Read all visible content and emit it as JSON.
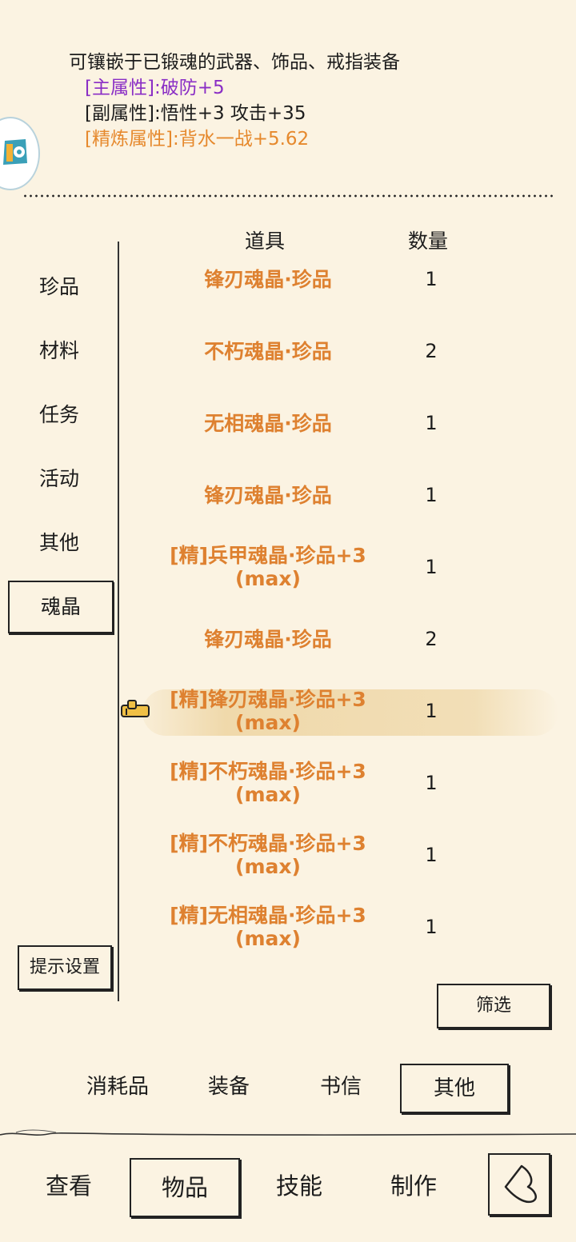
{
  "description": {
    "line1": "可镶嵌于已锻魂的武器、饰品、戒指装备",
    "main_attr": "[主属性]:破防+5",
    "sub_attr": "[副属性]:悟性+3 攻击+35",
    "refine_attr": "[精炼属性]:背水一战+5.62"
  },
  "table_header": {
    "item": "道具",
    "count": "数量"
  },
  "categories": [
    {
      "label": "珍品"
    },
    {
      "label": "材料"
    },
    {
      "label": "任务"
    },
    {
      "label": "活动"
    },
    {
      "label": "其他"
    },
    {
      "label": "魂晶"
    }
  ],
  "active_category": "魂晶",
  "items": [
    {
      "name": "锋刃魂晶·珍品",
      "qty": "1"
    },
    {
      "name": "不朽魂晶·珍品",
      "qty": "2"
    },
    {
      "name": "无相魂晶·珍品",
      "qty": "1"
    },
    {
      "name": "锋刃魂晶·珍品",
      "qty": "1"
    },
    {
      "name": "[精]兵甲魂晶·珍品+3\n(max)",
      "qty": "1"
    },
    {
      "name": "锋刃魂晶·珍品",
      "qty": "2"
    },
    {
      "name": "[精]锋刃魂晶·珍品+3\n(max)",
      "qty": "1"
    },
    {
      "name": "[精]不朽魂晶·珍品+3\n(max)",
      "qty": "1"
    },
    {
      "name": "[精]不朽魂晶·珍品+3\n(max)",
      "qty": "1"
    },
    {
      "name": "[精]无相魂晶·珍品+3\n(max)",
      "qty": "1"
    }
  ],
  "buttons": {
    "hint_settings": "提示设置",
    "filter": "筛选"
  },
  "sub_tabs": [
    {
      "label": "消耗品"
    },
    {
      "label": "装备"
    },
    {
      "label": "书信"
    },
    {
      "label": "其他"
    }
  ],
  "main_tabs": [
    {
      "label": "查看"
    },
    {
      "label": "物品"
    },
    {
      "label": "技能"
    },
    {
      "label": "制作"
    }
  ],
  "colors": {
    "item_name": "#de8130",
    "main_attr": "#8a2ec5",
    "refine_attr": "#e6892d",
    "background": "#fbf3e2"
  }
}
